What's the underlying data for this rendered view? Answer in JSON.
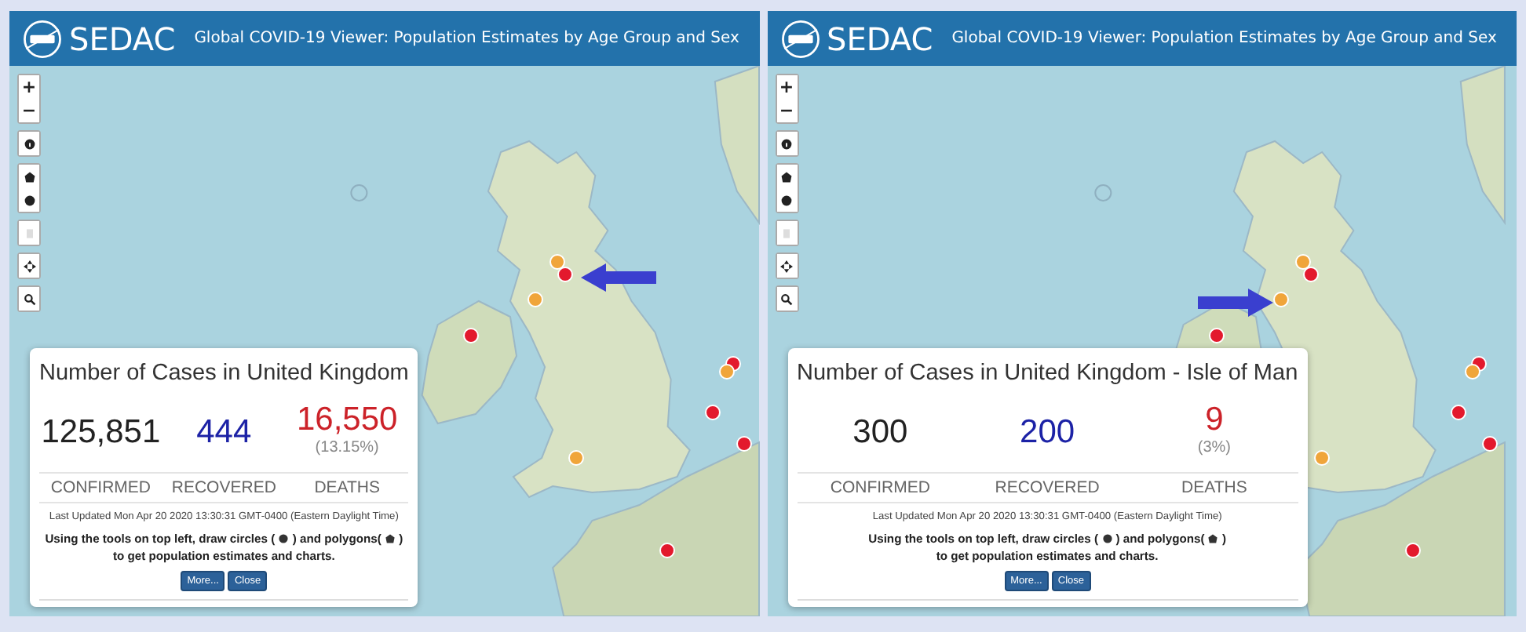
{
  "panels": [
    {
      "header": {
        "brand": "SEDAC",
        "title": "Global COVID-19 Viewer: Population Estimates by Age Group and Sex"
      },
      "zoom_controls": [
        "+",
        "−"
      ],
      "markers": [
        {
          "color": "#f0a53a"
        },
        {
          "color": "#e3192d"
        },
        {
          "color": "#f0a53a"
        },
        {
          "color": "#e3192d"
        },
        {
          "color": "#e3192d"
        },
        {
          "color": "#f0a53a"
        },
        {
          "color": "#e3192d"
        },
        {
          "color": "#e3192d"
        },
        {
          "color": "#f0a53a"
        },
        {
          "color": "#e3192d"
        }
      ],
      "arrow": {
        "points_right": false
      },
      "popup": {
        "title": "Number of Cases in United Kingdom",
        "stats": [
          {
            "kind": "confirmed",
            "value": "125,851",
            "label": "CONFIRMED"
          },
          {
            "kind": "recovered",
            "value": "444",
            "label": "RECOVERED"
          },
          {
            "kind": "deaths",
            "value": "16,550",
            "note": "(13.15%)",
            "label": "DEATHS"
          }
        ],
        "updated": "Last Updated Mon Apr 20 2020 13:30:31 GMT-0400 (Eastern Daylight Time)",
        "instructions": [
          "Using the tools on top left, draw circles (",
          ") and polygons(",
          ")",
          "to get population estimates and charts."
        ],
        "buttons": [
          "More...",
          "Close"
        ]
      }
    },
    {
      "header": {
        "brand": "SEDAC",
        "title": "Global COVID-19 Viewer: Population Estimates by Age Group and Sex"
      },
      "zoom_controls": [
        "+",
        "−"
      ],
      "markers": [
        {
          "color": "#f0a53a"
        },
        {
          "color": "#e3192d"
        },
        {
          "color": "#f0a53a"
        },
        {
          "color": "#e3192d"
        },
        {
          "color": "#e3192d"
        },
        {
          "color": "#f0a53a"
        },
        {
          "color": "#e3192d"
        },
        {
          "color": "#e3192d"
        },
        {
          "color": "#f0a53a"
        },
        {
          "color": "#e3192d"
        }
      ],
      "arrow": {
        "points_right": true
      },
      "popup": {
        "title": "Number of Cases in United Kingdom - Isle of Man",
        "stats": [
          {
            "kind": "confirmed",
            "value": "300",
            "label": "CONFIRMED"
          },
          {
            "kind": "recovered",
            "value": "200",
            "label": "RECOVERED"
          },
          {
            "kind": "deaths",
            "value": "9",
            "note": "(3%)",
            "label": "DEATHS"
          }
        ],
        "updated": "Last Updated Mon Apr 20 2020 13:30:31 GMT-0400 (Eastern Daylight Time)",
        "instructions": [
          "Using the tools on top left, draw circles (",
          ") and polygons(",
          ")",
          "to get population estimates and charts."
        ],
        "buttons": [
          "More...",
          "Close"
        ]
      }
    }
  ]
}
